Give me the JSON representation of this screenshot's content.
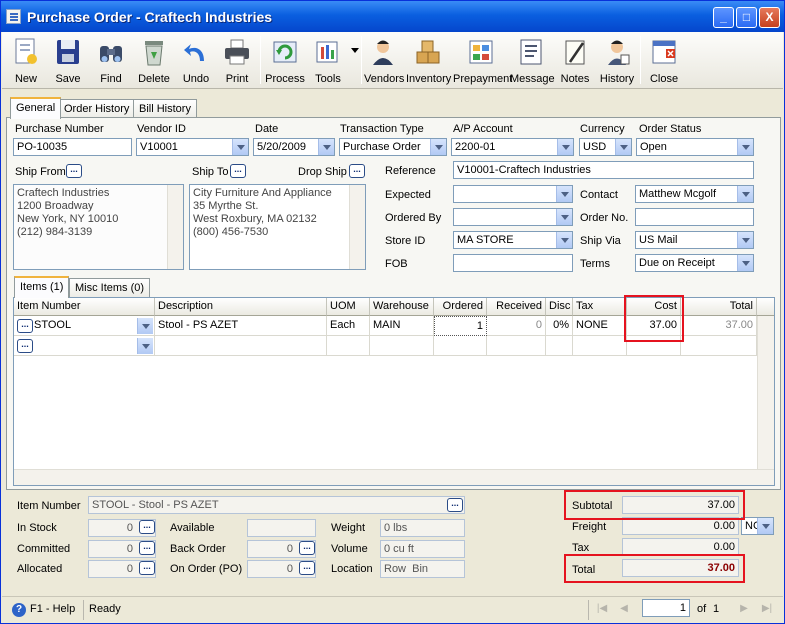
{
  "window": {
    "title": "Purchase Order - Craftech Industries",
    "minimize": "_",
    "maximize": "□",
    "close": "X"
  },
  "toolbar": {
    "buttons": [
      {
        "label": "New",
        "icon": "new-document-icon"
      },
      {
        "label": "Save",
        "icon": "floppy-disk-icon"
      },
      {
        "label": "Find",
        "icon": "binoculars-icon"
      },
      {
        "label": "Delete",
        "icon": "recycle-bin-icon"
      },
      {
        "label": "Undo",
        "icon": "undo-arrow-icon"
      },
      {
        "label": "Print",
        "icon": "printer-icon"
      },
      {
        "label": "Process",
        "icon": "process-icon"
      },
      {
        "label": "Tools",
        "icon": "tools-icon"
      },
      {
        "label": "Vendors",
        "icon": "vendor-person-icon"
      },
      {
        "label": "Inventory",
        "icon": "boxes-icon"
      },
      {
        "label": "Prepayment",
        "icon": "prepayment-icon"
      },
      {
        "label": "Message",
        "icon": "message-icon"
      },
      {
        "label": "Notes",
        "icon": "notepad-icon"
      },
      {
        "label": "History",
        "icon": "history-icon"
      },
      {
        "label": "Close",
        "icon": "close-window-icon"
      }
    ]
  },
  "tabs": {
    "general": "General",
    "order_history": "Order History",
    "bill_history": "Bill History"
  },
  "fields": {
    "purchase_number_label": "Purchase Number",
    "purchase_number": "PO-10035",
    "vendor_id_label": "Vendor ID",
    "vendor_id": "V10001",
    "date_label": "Date",
    "date": "5/20/2009",
    "transaction_type_label": "Transaction Type",
    "transaction_type": "Purchase Order",
    "ap_account_label": "A/P Account",
    "ap_account": "2200-01",
    "currency_label": "Currency",
    "currency": "USD",
    "order_status_label": "Order Status",
    "order_status": "Open",
    "ship_from_label": "Ship From",
    "ship_to_label": "Ship To",
    "drop_ship_label": "Drop Ship",
    "ship_from": [
      "Craftech Industries",
      "1200 Broadway",
      "New York, NY 10010",
      "(212) 984-3139"
    ],
    "ship_to": [
      "City Furniture And Appliance",
      "35 Myrthe St.",
      "West Roxbury, MA 02132",
      "(800) 456-7530"
    ],
    "reference_label": "Reference",
    "reference": "V10001-Craftech Industries",
    "expected_label": "Expected",
    "expected": "",
    "contact_label": "Contact",
    "contact": "Matthew Mcgolf",
    "ordered_by_label": "Ordered By",
    "ordered_by": "",
    "order_no_label": "Order No.",
    "order_no": "",
    "store_id_label": "Store ID",
    "store_id": "MA STORE",
    "ship_via_label": "Ship Via",
    "ship_via": "US Mail",
    "fob_label": "FOB",
    "fob": "",
    "terms_label": "Terms",
    "terms": "Due on Receipt"
  },
  "item_tabs": {
    "items": "Items (1)",
    "misc_items": "Misc Items (0)"
  },
  "grid": {
    "headers": [
      "Item Number",
      "Description",
      "UOM",
      "Warehouse",
      "Ordered",
      "Received",
      "Disc",
      "Tax",
      "Cost",
      "Total"
    ],
    "rows": [
      {
        "item_number": "STOOL",
        "description": "Stool - PS AZET",
        "uom": "Each",
        "warehouse": "MAIN",
        "ordered": "1",
        "received": "0",
        "disc": "0%",
        "tax": "NONE",
        "cost": "37.00",
        "total": "37.00"
      }
    ]
  },
  "details": {
    "item_number_label": "Item Number",
    "item_number": "STOOL - Stool - PS AZET",
    "in_stock_label": "In Stock",
    "in_stock": "0",
    "committed_label": "Committed",
    "committed": "0",
    "allocated_label": "Allocated",
    "allocated": "0",
    "available_label": "Available",
    "available": "",
    "back_order_label": "Back Order",
    "back_order": "0",
    "on_order_label": "On Order (PO)",
    "on_order": "0",
    "weight_label": "Weight",
    "weight": "0 lbs",
    "volume_label": "Volume",
    "volume": "0 cu ft",
    "location_label": "Location",
    "location": "Row  Bin"
  },
  "totals": {
    "subtotal_label": "Subtotal",
    "subtotal": "37.00",
    "freight_label": "Freight",
    "freight": "0.00",
    "freight_code": "NC",
    "tax_label": "Tax",
    "tax": "0.00",
    "total_label": "Total",
    "total": "37.00"
  },
  "status": {
    "help": "F1 - Help",
    "state": "Ready",
    "page": "1",
    "of_label": "of",
    "pages": "1"
  },
  "colors": {
    "highlight": "#e5131f",
    "title_bar": "#0a5fe0",
    "total_text": "#8b0000"
  }
}
